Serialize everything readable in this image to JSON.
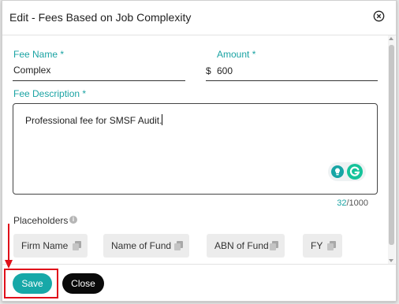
{
  "dialog": {
    "title": "Edit - Fees Based on Job Complexity"
  },
  "form": {
    "fee_name": {
      "label": "Fee Name *",
      "value": "Complex"
    },
    "amount": {
      "label": "Amount *",
      "currency": "$",
      "value": "600"
    },
    "fee_description": {
      "label": "Fee Description *",
      "value": "Professional fee for SMSF Audit.",
      "count_current": "32",
      "count_max": "/1000"
    }
  },
  "placeholders": {
    "label": "Placeholders",
    "chips": [
      {
        "label": "Firm Name"
      },
      {
        "label": "Name of Fund"
      },
      {
        "label": "ABN of Fund"
      },
      {
        "label": "FY"
      }
    ]
  },
  "footer": {
    "save_label": "Save",
    "close_label": "Close"
  },
  "colors": {
    "accent": "#1aa3a3",
    "save_button": "#17a8a8",
    "close_button": "#0a0a0a",
    "annotation_red": "#e0101a"
  }
}
